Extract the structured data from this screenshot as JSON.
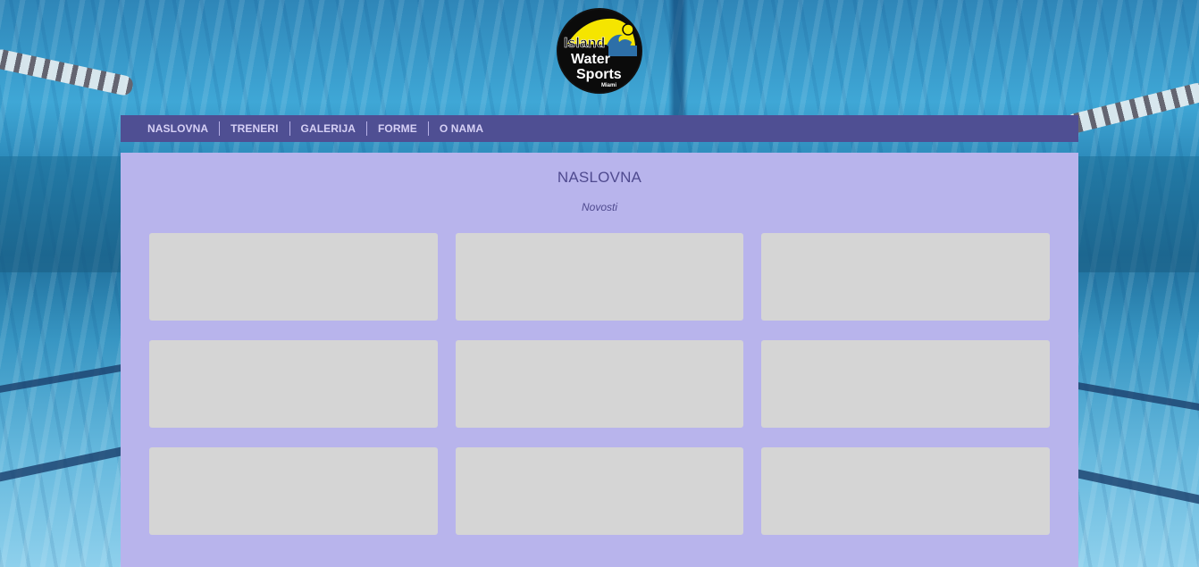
{
  "logo": {
    "line1": "Island",
    "line2": "Water",
    "line3": "Sports",
    "line4": "Miami",
    "accent": "#f5e500",
    "wave_color": "#2d6fa8"
  },
  "nav": {
    "items": [
      {
        "label": "NASLOVNA"
      },
      {
        "label": "TRENERI"
      },
      {
        "label": "GALERIJA"
      },
      {
        "label": "FORME"
      },
      {
        "label": "O NAMA"
      }
    ]
  },
  "main": {
    "title": "NASLOVNA",
    "subtitle": "Novosti",
    "cards": [
      "",
      "",
      "",
      "",
      "",
      "",
      "",
      "",
      ""
    ]
  },
  "colors": {
    "nav_bg": "#4f4f93",
    "panel_bg": "#b8b4ec",
    "card_bg": "#d5d5d5",
    "title_text": "#4f4a8f"
  }
}
